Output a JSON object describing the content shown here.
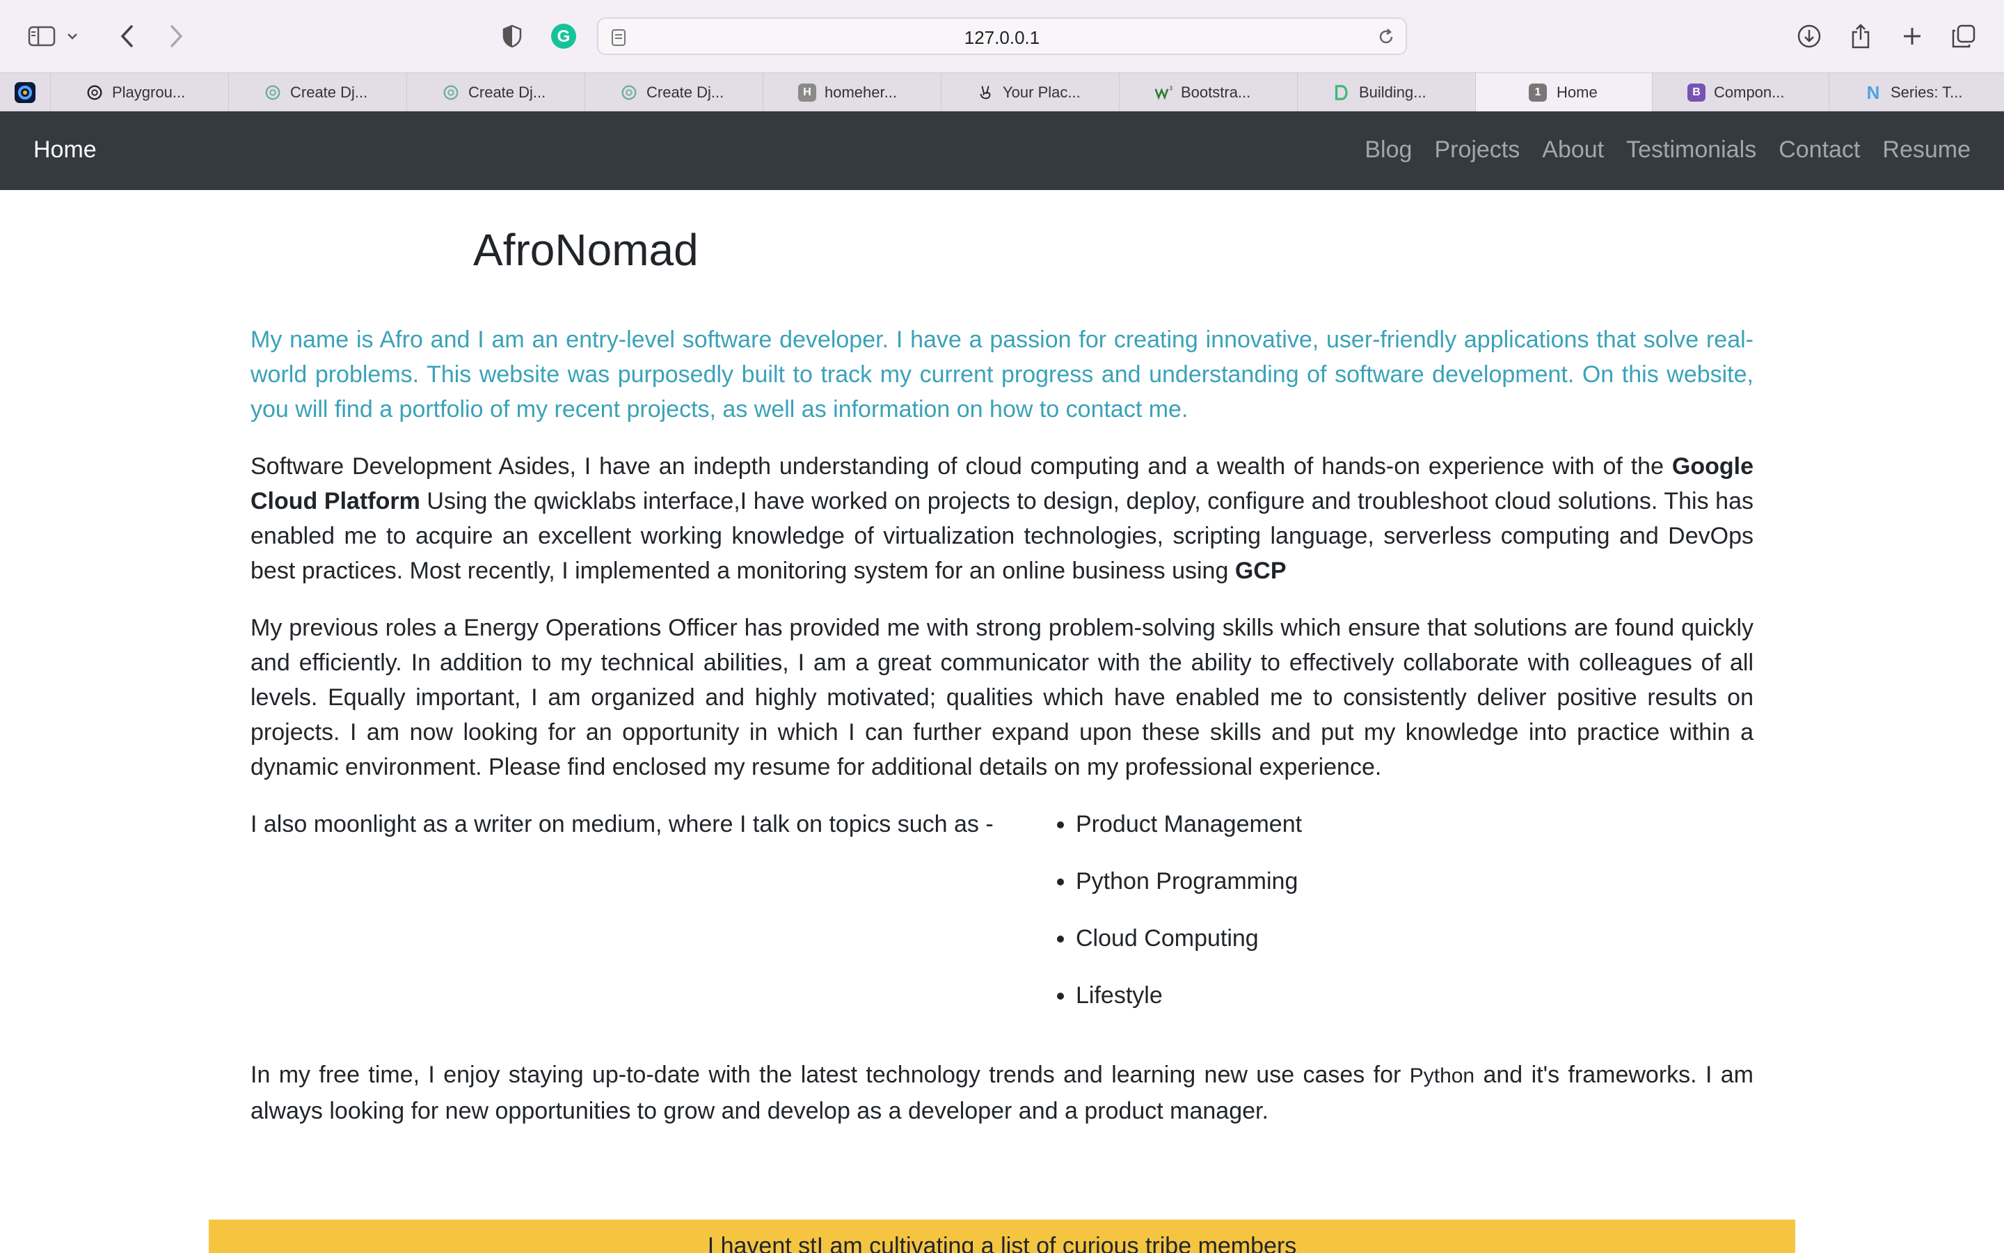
{
  "browser": {
    "url": "127.0.0.1",
    "tabs": [
      {
        "label": "Playgrou...",
        "favicon": "openai-icon",
        "color": "#222222"
      },
      {
        "label": "Create Dj...",
        "favicon": "chatgpt-icon",
        "color": "#6ab09a"
      },
      {
        "label": "Create Dj...",
        "favicon": "chatgpt-icon",
        "color": "#6ab09a"
      },
      {
        "label": "Create Dj...",
        "favicon": "chatgpt-icon",
        "color": "#6ab09a"
      },
      {
        "label": "homeher...",
        "favicon": "letter-h-icon",
        "color": "#8a8a8a"
      },
      {
        "label": "Your Plac...",
        "favicon": "angellist-icon",
        "color": "#222222"
      },
      {
        "label": "Bootstra...",
        "favicon": "w3-icon",
        "color": "#2e7d32"
      },
      {
        "label": "Building...",
        "favicon": "d-icon",
        "color": "#3cba78"
      },
      {
        "label": "Home",
        "favicon": "number-1-icon",
        "color": "#777777",
        "active": true
      },
      {
        "label": "Compon...",
        "favicon": "bootstrap-icon",
        "color": "#7952b3"
      },
      {
        "label": "Series: T...",
        "favicon": "n-icon",
        "color": "#4aa3df"
      }
    ],
    "tab_favicon_letters": {
      "homeher": "H",
      "home": "1",
      "bootstrap": "B",
      "n": "N"
    }
  },
  "navbar": {
    "brand": "Home",
    "links": [
      "Blog",
      "Projects",
      "About",
      "Testimonials",
      "Contact",
      "Resume"
    ]
  },
  "page": {
    "title": "AfroNomad",
    "intro": "My name is Afro and I am an entry-level software developer. I have a passion for creating innovative, user-friendly applications that solve real-world problems. This website was purposedly built to track my current progress and understanding of software development. On this website, you will find a portfolio of my recent projects, as well as information on how to contact me.",
    "cloud": {
      "part1": "Software Development Asides, I have an indepth understanding of cloud computing and a wealth of hands-on experience with of the ",
      "bold1": "Google Cloud Platform",
      "part2": " Using the qwicklabs interface,I have worked on projects to design, deploy, configure and troubleshoot cloud solutions. This has enabled me to acquire an excellent working knowledge of virtualization technologies, scripting language, serverless computing and DevOps best practices. Most recently, I implemented a monitoring system for an online business using ",
      "bold2": "GCP"
    },
    "previous_roles": "My previous roles a Energy Operations Officer has provided me with strong problem-solving skills which ensure that solutions are found quickly and efficiently. In addition to my technical abilities, I am a great communicator with the ability to effectively collaborate with colleagues of all levels. Equally important, I am organized and highly motivated; qualities which have enabled me to consistently deliver positive results on projects. I am now looking for an opportunity in which I can further expand upon these skills and put my knowledge into practice within a dynamic environment. Please find enclosed my resume for additional details on my professional experience.",
    "topics_intro": "I also moonlight as a writer on medium, where I talk on topics such as -",
    "topics": [
      "Product Management",
      "Python Programming",
      "Cloud Computing",
      "Lifestyle"
    ],
    "free_time": {
      "part1": "In my free time, I enjoy staying up-to-date with the latest technology trends and learning new use cases for ",
      "code": "Python",
      "part2": " and it's frameworks. I am always looking for new opportunities to grow and develop as a developer and a product manager."
    },
    "banner": "I havent stI am cultivating a list of curious tribe members"
  },
  "colors": {
    "navbar_bg": "#343a40",
    "intro_text": "#3aa2b8",
    "banner_bg": "#f5c542"
  }
}
